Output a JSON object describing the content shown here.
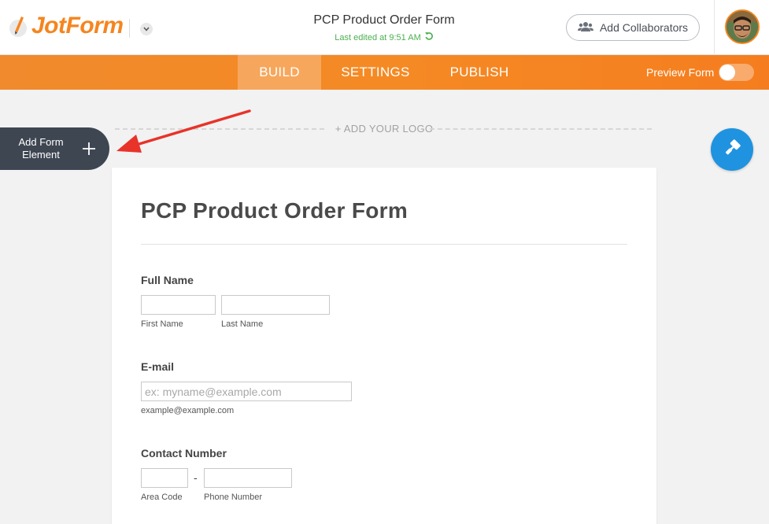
{
  "header": {
    "brand": "JotForm",
    "form_title": "PCP Product Order Form",
    "last_edited": "Last edited at 9:51 AM",
    "collaborators_label": "Add Collaborators"
  },
  "nav": {
    "tabs": [
      {
        "label": "BUILD",
        "active": true
      },
      {
        "label": "SETTINGS",
        "active": false
      },
      {
        "label": "PUBLISH",
        "active": false
      }
    ],
    "preview_label": "Preview Form",
    "preview_on": false
  },
  "builder": {
    "add_logo": "+ ADD YOUR LOGO",
    "add_element_line1": "Add Form",
    "add_element_line2": "Element"
  },
  "form": {
    "title": "PCP Product Order Form",
    "full_name": {
      "label": "Full Name",
      "first_sublabel": "First Name",
      "last_sublabel": "Last Name"
    },
    "email": {
      "label": "E-mail",
      "placeholder": "ex: myname@example.com",
      "sublabel": "example@example.com"
    },
    "contact": {
      "label": "Contact Number",
      "separator": "-",
      "area_sublabel": "Area Code",
      "phone_sublabel": "Phone Number"
    }
  },
  "colors": {
    "brand_orange": "#f5851f",
    "accent_blue": "#1f93e0",
    "dark_panel": "#3e4652",
    "annotation_red": "#e8332a"
  }
}
